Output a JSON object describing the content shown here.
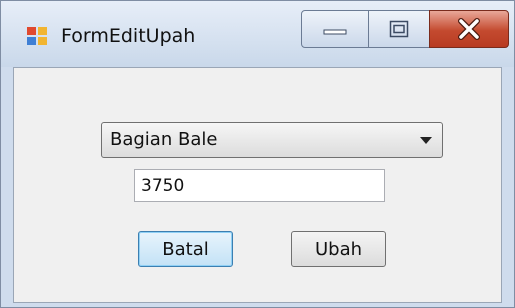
{
  "window": {
    "title": "FormEditUpah"
  },
  "caption_buttons": {
    "minimize_icon": "minimize-icon",
    "maximize_icon": "maximize-icon",
    "close_icon": "close-icon"
  },
  "form": {
    "bagian_select": {
      "selected": "Bagian Bale"
    },
    "upah_input": {
      "value": "3750"
    },
    "buttons": {
      "batal": "Batal",
      "ubah": "Ubah"
    }
  },
  "colors": {
    "close_button": "#c44a2f",
    "focused_button_border": "#3c7fb1"
  }
}
